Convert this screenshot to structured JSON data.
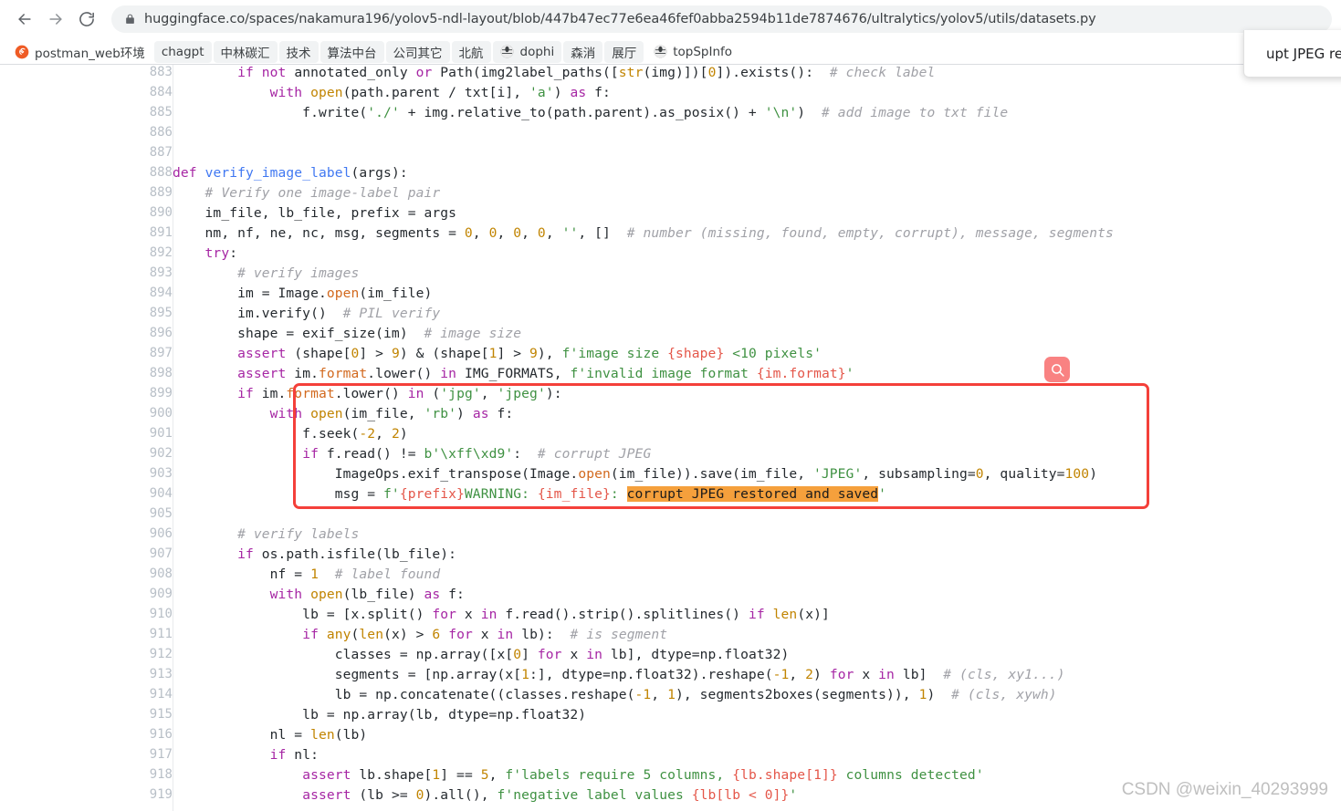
{
  "browser": {
    "back_label": "Back",
    "forward_label": "Forward",
    "reload_label": "Reload",
    "lock_label": "View site information",
    "url": "huggingface.co/spaces/nakamura196/yolov5-ndl-layout/blob/447b47ec77e6ea46fef0abba2594b11de7874676/ultralytics/yolov5/utils/datasets.py"
  },
  "bookmarks": [
    {
      "label": "postman_web环境",
      "icon": "postman-icon",
      "boxed": false
    },
    {
      "label": "chagpt",
      "icon": "",
      "boxed": true
    },
    {
      "label": "中林碳汇",
      "icon": "",
      "boxed": true
    },
    {
      "label": "技术",
      "icon": "",
      "boxed": true
    },
    {
      "label": "算法中台",
      "icon": "",
      "boxed": true
    },
    {
      "label": "公司其它",
      "icon": "",
      "boxed": true
    },
    {
      "label": "北航",
      "icon": "",
      "boxed": true
    },
    {
      "label": "dophi",
      "icon": "globe-icon",
      "boxed": true
    },
    {
      "label": "森消",
      "icon": "",
      "boxed": true
    },
    {
      "label": "展厅",
      "icon": "",
      "boxed": true
    },
    {
      "label": "topSpInfo",
      "icon": "globe-icon",
      "boxed": false
    }
  ],
  "find_popup": {
    "text": "upt JPEG restore"
  },
  "floating_button": {
    "icon": "search-icon",
    "label": "Search",
    "color": "#f98282"
  },
  "annotation": {
    "box_color": "#f4403a",
    "highlight_color": "#f5a03c"
  },
  "watermark": {
    "text": "CSDN @weixin_40293999"
  },
  "code": {
    "language": "python",
    "first_line": 883,
    "lines": [
      {
        "n": "883",
        "html": "        <span class=\"kw\">if</span> <span class=\"kw\">not</span> annotated_only <span class=\"kw\">or</span> Path(img2label_paths([<span class=\"bi\">str</span>(img)])[<span class=\"num\">0</span>]).exists():  <span class=\"cmt\"># check label</span>"
      },
      {
        "n": "884",
        "html": "            <span class=\"kw\">with</span> <span class=\"bi\">open</span>(path.parent / txt[i], <span class=\"str\">'a'</span>) <span class=\"kw\">as</span> f:"
      },
      {
        "n": "885",
        "html": "                f.write(<span class=\"str\">'./'</span> + img.relative_to(path.parent).as_posix() + <span class=\"str\">'\\n'</span>)  <span class=\"cmt\"># add image to txt file</span>"
      },
      {
        "n": "886",
        "html": ""
      },
      {
        "n": "887",
        "html": ""
      },
      {
        "n": "888",
        "html": "<span class=\"kw\">def</span> <span class=\"fn\">verify_image_label</span>(args):"
      },
      {
        "n": "889",
        "html": "    <span class=\"cmt\"># Verify one image-label pair</span>"
      },
      {
        "n": "890",
        "html": "    im_file, lb_file, prefix = args"
      },
      {
        "n": "891",
        "html": "    nm, nf, ne, nc, msg, segments = <span class=\"num\">0</span>, <span class=\"num\">0</span>, <span class=\"num\">0</span>, <span class=\"num\">0</span>, <span class=\"str\">''</span>, []  <span class=\"cmt\"># number (missing, found, empty, corrupt), message, segments</span>"
      },
      {
        "n": "892",
        "html": "    <span class=\"kw\">try</span>:"
      },
      {
        "n": "893",
        "html": "        <span class=\"cmt\"># verify images</span>"
      },
      {
        "n": "894",
        "html": "        im = Image.<span class=\"meth\">open</span>(im_file)"
      },
      {
        "n": "895",
        "html": "        im.verify()  <span class=\"cmt\"># PIL verify</span>"
      },
      {
        "n": "896",
        "html": "        shape = exif_size(im)  <span class=\"cmt\"># image size</span>"
      },
      {
        "n": "897",
        "html": "        <span class=\"kw\">assert</span> (shape[<span class=\"num\">0</span>] &gt; <span class=\"num\">9</span>) &amp; (shape[<span class=\"num\">1</span>] &gt; <span class=\"num\">9</span>), <span class=\"str\">f'image size <span class=\"fstr-br\">{shape}</span> &lt;10 pixels'</span>"
      },
      {
        "n": "898",
        "html": "        <span class=\"kw\">assert</span> im.<span class=\"meth\">format</span>.lower() <span class=\"kw\">in</span> IMG_FORMATS, <span class=\"str\">f'invalid image format <span class=\"fstr-br\">{im.format}</span>'</span>"
      },
      {
        "n": "899",
        "html": "        <span class=\"kw\">if</span> im.<span class=\"meth\">format</span>.lower() <span class=\"kw\">in</span> (<span class=\"str\">'jpg'</span>, <span class=\"str\">'jpeg'</span>):"
      },
      {
        "n": "900",
        "html": "            <span class=\"kw\">with</span> <span class=\"bi\">open</span>(im_file, <span class=\"str\">'rb'</span>) <span class=\"kw\">as</span> f:"
      },
      {
        "n": "901",
        "html": "                f.seek(<span class=\"num\">-2</span>, <span class=\"num\">2</span>)"
      },
      {
        "n": "902",
        "html": "                <span class=\"kw\">if</span> f.read() != <span class=\"str\">b'\\xff\\xd9'</span>:  <span class=\"cmt\"># corrupt JPEG</span>"
      },
      {
        "n": "903",
        "html": "                    ImageOps.exif_transpose(Image.<span class=\"meth\">open</span>(im_file)).save(im_file, <span class=\"str\">'JPEG'</span>, subsampling=<span class=\"num\">0</span>, quality=<span class=\"num\">100</span>)"
      },
      {
        "n": "904",
        "html": "                    msg = <span class=\"str\">f'<span class=\"fstr-br\">{prefix}</span>WARNING: <span class=\"fstr-br\">{im_file}</span>: <span class=\"hl\">corrupt JPEG restored and saved</span>'</span>"
      },
      {
        "n": "905",
        "html": ""
      },
      {
        "n": "906",
        "html": "        <span class=\"cmt\"># verify labels</span>"
      },
      {
        "n": "907",
        "html": "        <span class=\"kw\">if</span> os.path.isfile(lb_file):"
      },
      {
        "n": "908",
        "html": "            nf = <span class=\"num\">1</span>  <span class=\"cmt\"># label found</span>"
      },
      {
        "n": "909",
        "html": "            <span class=\"kw\">with</span> <span class=\"bi\">open</span>(lb_file) <span class=\"kw\">as</span> f:"
      },
      {
        "n": "910",
        "html": "                lb = [x.split() <span class=\"kw\">for</span> x <span class=\"kw\">in</span> f.read().strip().splitlines() <span class=\"kw\">if</span> <span class=\"bi\">len</span>(x)]"
      },
      {
        "n": "911",
        "html": "                <span class=\"kw\">if</span> <span class=\"bi\">any</span>(<span class=\"bi\">len</span>(x) &gt; <span class=\"num\">6</span> <span class=\"kw\">for</span> x <span class=\"kw\">in</span> lb):  <span class=\"cmt\"># is segment</span>"
      },
      {
        "n": "912",
        "html": "                    classes = np.array([x[<span class=\"num\">0</span>] <span class=\"kw\">for</span> x <span class=\"kw\">in</span> lb], dtype=np.float32)"
      },
      {
        "n": "913",
        "html": "                    segments = [np.array(x[<span class=\"num\">1</span>:], dtype=np.float32).reshape(<span class=\"num\">-1</span>, <span class=\"num\">2</span>) <span class=\"kw\">for</span> x <span class=\"kw\">in</span> lb]  <span class=\"cmt\"># (cls, xy1...)</span>"
      },
      {
        "n": "914",
        "html": "                    lb = np.concatenate((classes.reshape(<span class=\"num\">-1</span>, <span class=\"num\">1</span>), segments2boxes(segments)), <span class=\"num\">1</span>)  <span class=\"cmt\"># (cls, xywh)</span>"
      },
      {
        "n": "915",
        "html": "                lb = np.array(lb, dtype=np.float32)"
      },
      {
        "n": "916",
        "html": "            nl = <span class=\"bi\">len</span>(lb)"
      },
      {
        "n": "917",
        "html": "            <span class=\"kw\">if</span> nl:"
      },
      {
        "n": "918",
        "html": "                <span class=\"kw\">assert</span> lb.shape[<span class=\"num\">1</span>] == <span class=\"num\">5</span>, <span class=\"str\">f'labels require 5 columns, <span class=\"fstr-br\">{lb.shape[1]}</span> columns detected'</span>"
      },
      {
        "n": "919",
        "html": "                <span class=\"kw\">assert</span> (lb &gt;= <span class=\"num\">0</span>).all(), <span class=\"str\">f'negative label values <span class=\"fstr-br\">{lb[lb &lt; 0]}</span>'</span>"
      }
    ]
  }
}
